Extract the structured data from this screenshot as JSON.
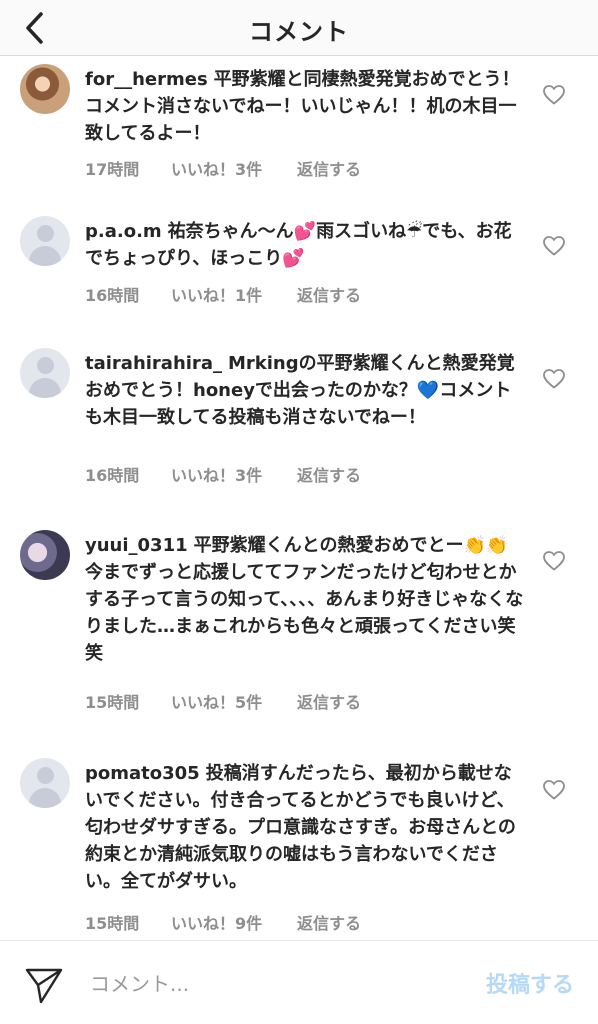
{
  "header": {
    "title": "コメント"
  },
  "comments": [
    {
      "username": "for__hermes",
      "text": "平野紫耀と同棲熱愛発覚おめでとう！コメント消さないでねー！いいじゃん！！机の木目一致してるよー！",
      "time": "17時間",
      "likes": "いいね！3件",
      "reply": "返信する"
    },
    {
      "username": "p.a.o.m",
      "text": "祐奈ちゃん〜ん💕雨スゴいね☔でも、お花でちょっぴり、ほっこり💕",
      "time": "16時間",
      "likes": "いいね！1件",
      "reply": "返信する"
    },
    {
      "username": "tairahirahira_",
      "text": "Mrkingの平野紫耀くんと熱愛発覚おめでとう！honeyで出会ったのかな？💙コメントも木目一致してる投稿も消さないでねー！",
      "time": "16時間",
      "likes": "いいね！3件",
      "reply": "返信する"
    },
    {
      "username": "yuui_0311",
      "text": "平野紫耀くんとの熱愛おめでとー👏👏今までずっと応援しててファンだったけど匂わせとかする子って言うの知って、、、、あんまり好きじゃなくなりました…まぁこれからも色々と頑張ってください笑笑",
      "time": "15時間",
      "likes": "いいね！5件",
      "reply": "返信する"
    },
    {
      "username": "pomato305",
      "text": "投稿消すんだったら、最初から載せないでください。付き合ってるとかどうでも良いけど、匂わせダサすぎる。プロ意識なさすぎ。お母さんとの約束とか清純派気取りの嘘はもう言わないでください。全てがダサい。",
      "time": "15時間",
      "likes": "いいね！9件",
      "reply": "返信する"
    }
  ],
  "composer": {
    "placeholder": "コメント...",
    "post_label": "投稿する"
  },
  "icons": {
    "back": "chevron-left-icon",
    "heart": "heart-outline-icon",
    "send": "paper-plane-icon"
  },
  "colors": {
    "post_disabled": "#b6d9f7",
    "meta_gray": "#8e8e8e"
  }
}
